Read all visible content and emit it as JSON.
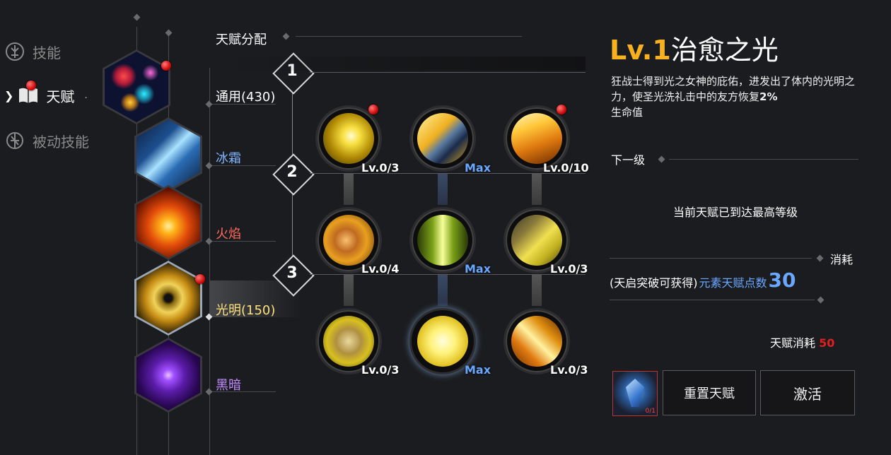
{
  "sidebar": {
    "items": [
      {
        "label": "技能",
        "icon": "skill-icon"
      },
      {
        "label": "天赋",
        "icon": "book-icon"
      },
      {
        "label": "被动技能",
        "icon": "passive-icon"
      }
    ],
    "active_marker": "."
  },
  "allocation": {
    "title": "天赋分配",
    "categories": [
      {
        "label": "通用(430)",
        "color": "#ffffff"
      },
      {
        "label": "冰霜",
        "color": "#7fb4ff"
      },
      {
        "label": "火焰",
        "color": "#ff6b5b"
      },
      {
        "label": "光明(150)",
        "color": "#ffe27a"
      },
      {
        "label": "黑暗",
        "color": "#c18cff"
      }
    ]
  },
  "tiers": [
    "1",
    "2",
    "3"
  ],
  "skills": [
    {
      "level": "Lv.0/3",
      "max": false,
      "icon": "light-burst-icon"
    },
    {
      "level": "Max",
      "max": true,
      "icon": "light-sword-icon"
    },
    {
      "level": "Lv.0/10",
      "max": false,
      "icon": "light-slash-icon"
    },
    {
      "level": "Lv.0/4",
      "max": false,
      "icon": "light-fist-icon"
    },
    {
      "level": "Max",
      "max": true,
      "icon": "light-pillar-icon"
    },
    {
      "level": "Lv.0/3",
      "max": false,
      "icon": "light-claw-icon"
    },
    {
      "level": "Lv.0/3",
      "max": false,
      "icon": "light-punch-icon"
    },
    {
      "level": "Max",
      "max": true,
      "icon": "heal-light-icon"
    },
    {
      "level": "Lv.0/3",
      "max": false,
      "icon": "light-streak-icon"
    }
  ],
  "detail": {
    "level": "Lv.1",
    "name": "治愈之光",
    "description_part1": "狂战士得到光之女神的庇佑，进发出了体内的光明之力，使圣光洗礼击中的友方恢复",
    "description_value": "2%",
    "description_part2": "生命值",
    "next_level_label": "下一级",
    "max_level_text": "当前天赋已到达最高等级",
    "cost_label": "消耗",
    "awaken_text": "(天启突破可获得)",
    "element_points_label": "元素天赋点数",
    "element_points_value": "30",
    "talent_cost_label": "天赋消耗",
    "talent_cost_value": "50",
    "item_count": "0/1",
    "reset_button": "重置天赋",
    "activate_button": "激活"
  },
  "colors": {
    "accent_gold": "#f7b11e",
    "element_blue": "#6aa8ff",
    "cost_red": "#e02020"
  }
}
